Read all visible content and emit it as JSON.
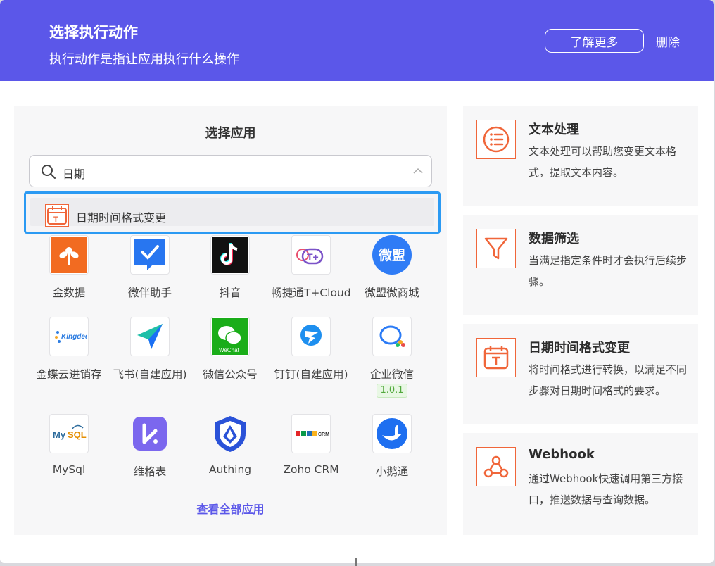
{
  "header": {
    "title": "选择执行动作",
    "subtitle": "执行动作是指让应用执行什么操作",
    "learn_more_label": "了解更多",
    "delete_label": "删除",
    "bg_color": "#5b57e9"
  },
  "left_panel": {
    "title": "选择应用",
    "search": {
      "value": "日期",
      "icon": "search-icon"
    },
    "dropdown": {
      "item_label": "日期时间格式变更",
      "icon": "calendar-icon"
    },
    "apps": [
      {
        "name": "金数据",
        "icon": "jinshuju-icon"
      },
      {
        "name": "微伴助手",
        "icon": "weiban-icon"
      },
      {
        "name": "抖音",
        "icon": "douyin-icon"
      },
      {
        "name": "畅捷通T+Cloud",
        "icon": "chanjet-icon"
      },
      {
        "name": "微盟微商城",
        "icon": "weimob-icon"
      },
      {
        "name": "金蝶云进销存",
        "icon": "kingdee-icon"
      },
      {
        "name": "飞书(自建应用)",
        "icon": "feishu-icon"
      },
      {
        "name": "微信公众号",
        "icon": "wechat-icon"
      },
      {
        "name": "钉钉(自建应用)",
        "icon": "dingtalk-icon"
      },
      {
        "name": "企业微信",
        "icon": "wecom-icon",
        "badge": "1.0.1"
      },
      {
        "name": "MySql",
        "icon": "mysql-icon"
      },
      {
        "name": "维格表",
        "icon": "vika-icon"
      },
      {
        "name": "Authing",
        "icon": "authing-icon"
      },
      {
        "name": "Zoho CRM",
        "icon": "zoho-crm-icon"
      },
      {
        "name": "小鹅通",
        "icon": "xiaoe-icon"
      }
    ],
    "view_all_label": "查看全部应用"
  },
  "cards": [
    {
      "title": "文本处理",
      "desc": "文本处理可以帮助您变更文本格式，提取文本内容。",
      "icon": "text-list-icon"
    },
    {
      "title": "数据筛选",
      "desc": "当满足指定条件时才会执行后续步骤。",
      "icon": "filter-icon"
    },
    {
      "title": "日期时间格式变更",
      "desc": "将时间格式进行转换，以满足不同步骤对日期时间格式的要求。",
      "icon": "calendar-icon"
    },
    {
      "title": "Webhook",
      "desc": "通过Webhook快速调用第三方接口，推送数据与查询数据。",
      "icon": "webhook-icon"
    }
  ],
  "accent_color": "#f0663a"
}
